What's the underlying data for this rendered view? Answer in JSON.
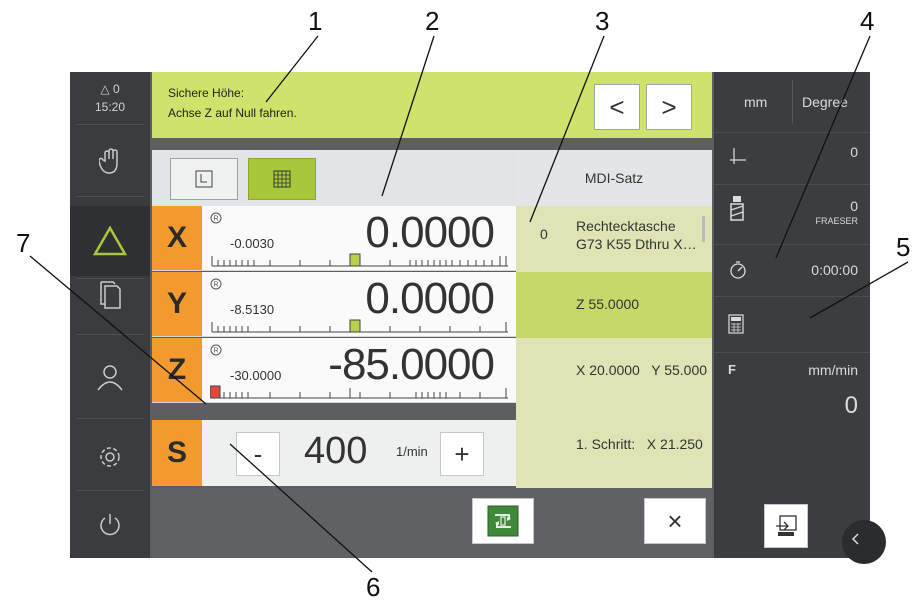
{
  "callouts": [
    "1",
    "2",
    "3",
    "4",
    "5",
    "6",
    "7"
  ],
  "status": {
    "delta_count": "0",
    "time": "15:20"
  },
  "message": {
    "line1": "Sichere Höhe:",
    "line2": "Achse Z auf Null fahren."
  },
  "nav": {
    "prev": "<",
    "next": ">"
  },
  "axes": [
    {
      "letter": "X",
      "ref": "-0.0030",
      "value": "0.0000"
    },
    {
      "letter": "Y",
      "ref": "-8.5130",
      "value": "0.0000"
    },
    {
      "letter": "Z",
      "ref": "-30.0000",
      "value": "-85.0000"
    }
  ],
  "spindle": {
    "letter": "S",
    "minus": "-",
    "plus": "+",
    "value": "400",
    "unit": "1/min"
  },
  "mdi": {
    "header": "MDI-Satz",
    "row1_index": "0",
    "row1_line1": "Rechtecktasche",
    "row1_line2": "G73 K55 Dthru X…",
    "row2": "Z 55.0000",
    "row3": "X 20.0000   Y 55.000",
    "row4": "1. Schritt:   X 21.250"
  },
  "bottom": {
    "close": "×"
  },
  "right_panel": {
    "unit_linear": "mm",
    "unit_angle": "Degree",
    "datum_value": "0",
    "tool_value": "0",
    "tool_name": "FRAESER",
    "timer": "0:00:00",
    "feed_label": "F",
    "feed_unit": "mm/min",
    "feed_value": "0"
  },
  "colors": {
    "orange": "#f39a2e",
    "green": "#cfe26b",
    "dark": "#3a3c3e"
  },
  "icons": [
    "hand-icon",
    "triangle-icon",
    "documents-icon",
    "user-icon",
    "gear-icon",
    "power-icon",
    "datum-icon",
    "tool-icon",
    "timer-icon",
    "calculator-icon",
    "cycle-start-icon",
    "export-icon"
  ]
}
